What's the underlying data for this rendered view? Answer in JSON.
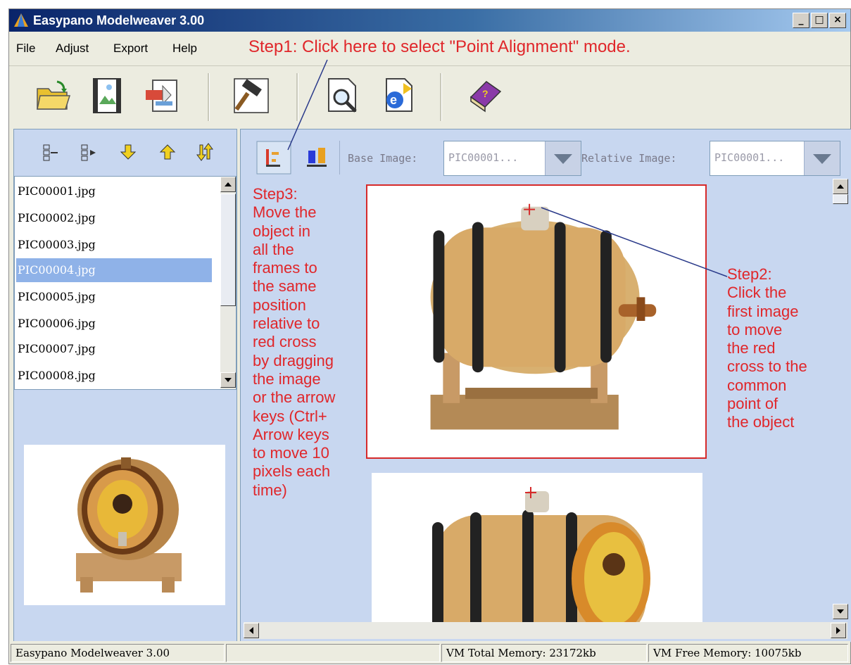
{
  "window": {
    "title": "Easypano Modelweaver 3.00"
  },
  "title_buttons": {
    "minimize": "_",
    "maximize": "□",
    "close": "×"
  },
  "menu": [
    {
      "label": "File",
      "mnemonic": "F"
    },
    {
      "label": "Adjust",
      "mnemonic": "j"
    },
    {
      "label": "Export",
      "mnemonic": "E"
    },
    {
      "label": "Help",
      "mnemonic": "H"
    }
  ],
  "toolbar": {
    "icons": [
      "open-folder-icon",
      "image-icon",
      "export-icon",
      "hammer-icon",
      "preview-icon",
      "browser-icon",
      "help-book-icon"
    ]
  },
  "left_tools": {
    "icons": [
      "align-left-icon",
      "align-right-icon",
      "arrow-down-icon",
      "arrow-up-icon",
      "reverse-icon"
    ]
  },
  "file_list": {
    "items": [
      "PIC00001.jpg",
      "PIC00002.jpg",
      "PIC00003.jpg",
      "PIC00004.jpg",
      "PIC00005.jpg",
      "PIC00006.jpg",
      "PIC00007.jpg",
      "PIC00008.jpg"
    ],
    "selected_index": 3
  },
  "alignment": {
    "base_label": "Base Image:",
    "base_value": "PIC00001...",
    "relative_label": "Relative Image:",
    "relative_value": "PIC00001..."
  },
  "annotations": {
    "step1": "Step1: Click here to select \"Point Alignment\" mode.",
    "step2": [
      "Step2:",
      "Click the",
      "first image",
      "to move",
      "the red",
      "cross to the",
      "common",
      "point of",
      "the object"
    ],
    "step3": [
      "Step3:",
      "Move the",
      "object in",
      "all the",
      "frames to",
      "the same",
      "position",
      "relative to",
      "red cross",
      "by dragging",
      "the image",
      "or the arrow",
      "keys (Ctrl+",
      "Arrow keys",
      "to move 10",
      "pixels each",
      "time)"
    ]
  },
  "status": {
    "app": "Easypano Modelweaver 3.00",
    "total_memory": "VM Total Memory: 23172kb",
    "free_memory": "VM Free Memory: 10075kb"
  },
  "colors": {
    "annotation": "#e0262a",
    "panel": "#c8d7f0",
    "selected": "#8fb2e8"
  }
}
